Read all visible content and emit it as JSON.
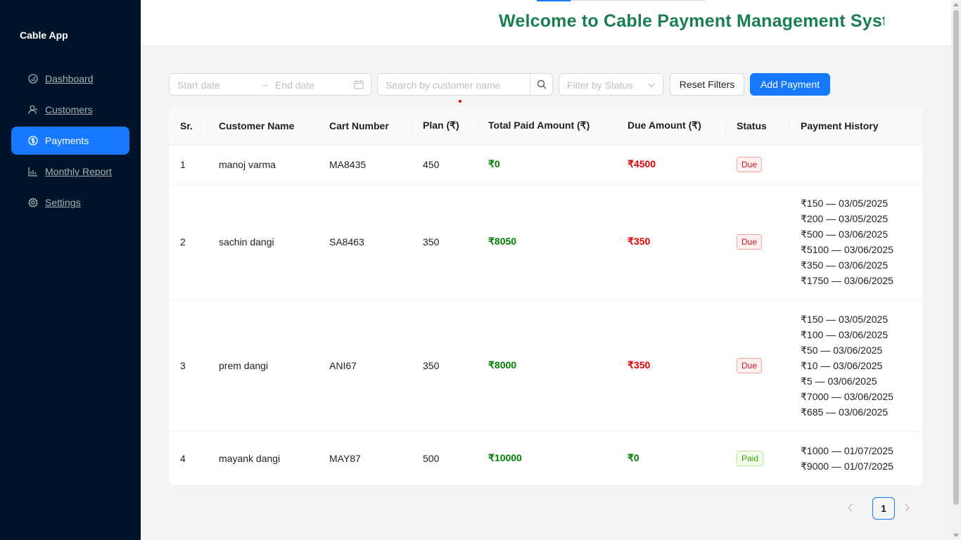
{
  "brand": "Cable App",
  "nav": {
    "dashboard": "Dashboard",
    "customers": "Customers",
    "payments": "Payments",
    "monthly_report": "Monthly Report",
    "settings": "Settings"
  },
  "header": {
    "title": "Welcome to Cable Payment Management System"
  },
  "filters": {
    "start_date_placeholder": "Start date",
    "end_date_placeholder": "End date",
    "search_placeholder": "Search by customer name",
    "status_placeholder": "Filter by Status",
    "reset_label": "Reset Filters",
    "add_label": "Add Payment"
  },
  "table": {
    "headers": {
      "sr": "Sr.",
      "customer_name": "Customer Name",
      "cart_number": "Cart Number",
      "plan": "Plan (₹)",
      "total_paid": "Total Paid Amount (₹)",
      "due": "Due Amount (₹)",
      "status": "Status",
      "history": "Payment History"
    },
    "rows": [
      {
        "sr": "1",
        "name": "manoj varma",
        "cart": "MA8435",
        "plan": "450",
        "paid": "₹0",
        "due": "₹4500",
        "status": "Due",
        "history": []
      },
      {
        "sr": "2",
        "name": "sachin dangi",
        "cart": "SA8463",
        "plan": "350",
        "paid": "₹8050",
        "due": "₹350",
        "status": "Due",
        "history": [
          "₹150 — 03/05/2025",
          "₹200 — 03/05/2025",
          "₹500 — 03/06/2025",
          "₹5100 — 03/06/2025",
          "₹350 — 03/06/2025",
          "₹1750 — 03/06/2025"
        ]
      },
      {
        "sr": "3",
        "name": "prem dangi",
        "cart": "ANI67",
        "plan": "350",
        "paid": "₹8000",
        "due": "₹350",
        "status": "Due",
        "history": [
          "₹150 — 03/05/2025",
          "₹100 — 03/06/2025",
          "₹50 — 03/06/2025",
          "₹10 — 03/06/2025",
          "₹5 — 03/06/2025",
          "₹7000 — 03/06/2025",
          "₹685 — 03/06/2025"
        ]
      },
      {
        "sr": "4",
        "name": "mayank dangi",
        "cart": "MAY87",
        "plan": "500",
        "paid": "₹10000",
        "due": "₹0",
        "status": "Paid",
        "history": [
          "₹1000 — 01/07/2025",
          "₹9000 — 01/07/2025"
        ]
      }
    ]
  },
  "pagination": {
    "current": "1"
  },
  "colors": {
    "sidebar": "#001529",
    "accent": "#1677ff",
    "title": "#1a7f4e",
    "paid": "#008000",
    "due": "#e00000"
  }
}
